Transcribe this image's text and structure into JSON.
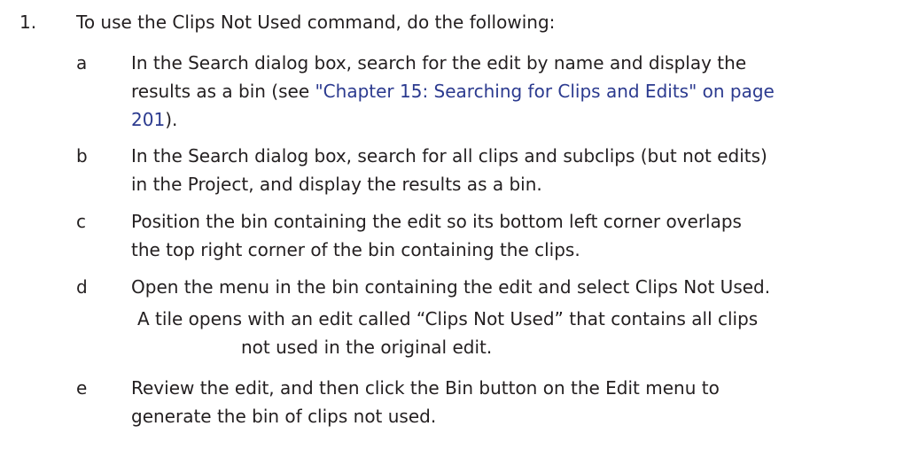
{
  "step": {
    "number": "1.",
    "text": "To use the Clips Not Used command, do the following:"
  },
  "substeps": [
    {
      "letter": "a",
      "line1": "In the Search dialog box, search for the edit by name and display the",
      "line2_prefix": "results as a bin (see ",
      "link_part1": "\"Chapter 15: Searching for Clips and Edits\" on page",
      "link_part2": "201",
      "line3_suffix": ")."
    },
    {
      "letter": "b",
      "line1": "In the Search dialog box, search for all clips and subclips (but not edits)",
      "line2": "in the Project, and display the results as a bin."
    },
    {
      "letter": "c",
      "line1": "Position the bin containing the edit so its bottom left corner overlaps",
      "line2": "the top right corner of the bin containing the clips."
    },
    {
      "letter": "d",
      "line1": "Open the menu in the bin containing the edit and select Clips Not Used."
    },
    {
      "letter": "e",
      "line1": "Review the edit, and then click the Bin button on the Edit menu to",
      "line2": "generate the bin of clips not used."
    }
  ],
  "note": {
    "line1": "A tile opens with an edit called “Clips Not Used” that contains all clips",
    "line2": "not used in the original edit."
  }
}
